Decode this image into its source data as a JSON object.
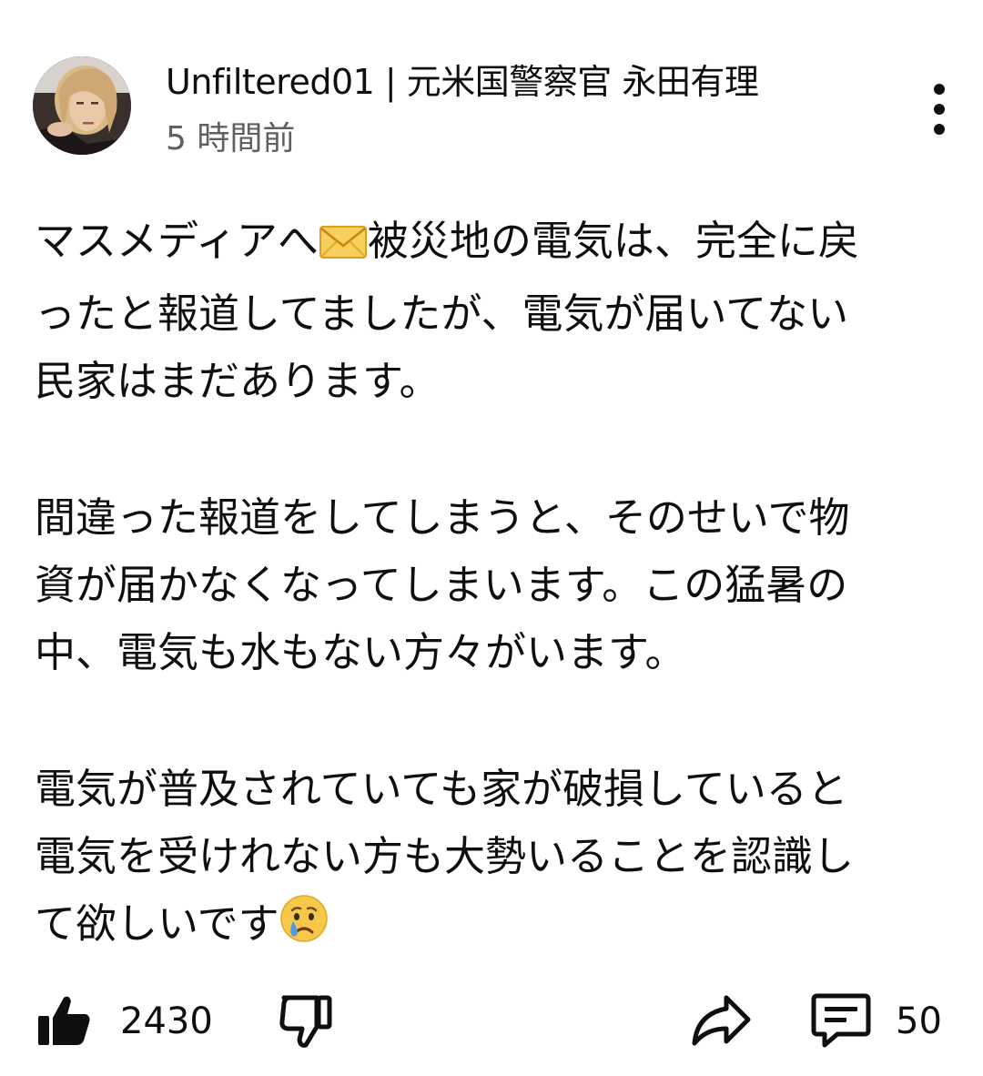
{
  "comment": {
    "author": "Unfiltered01 | 元米国警察官 永田有理",
    "timestamp": "5 時間前",
    "paragraphs": [
      {
        "lines": [
          {
            "before": "マスメディアへ",
            "emoji": "envelope",
            "after": "被災地の電気は、完全に戻"
          },
          {
            "text": "ったと報道してましたが、電気が届いてない"
          },
          {
            "text": "民家はまだあります。"
          }
        ]
      },
      {
        "lines": [
          {
            "text": "間違った報道をしてしまうと、そのせいで物"
          },
          {
            "text": "資が届かなくなってしまいます。この猛暑の"
          },
          {
            "text": "中、電気も水もない方々がいます。"
          }
        ]
      },
      {
        "lines": [
          {
            "text": "電気が普及されていても家が破損していると"
          },
          {
            "text": "電気を受けれない方も大勢いることを認識し"
          },
          {
            "before": "て欲しいです",
            "emoji": "crying-face"
          }
        ]
      }
    ]
  },
  "actions": {
    "like_count": "2430",
    "reply_count": "50",
    "icons": [
      "like-icon",
      "dislike-icon",
      "share-icon",
      "comment-icon",
      "more-vert-icon"
    ]
  },
  "colors": {
    "text": "#0f0f0f",
    "secondary": "#606060",
    "background": "#ffffff"
  }
}
